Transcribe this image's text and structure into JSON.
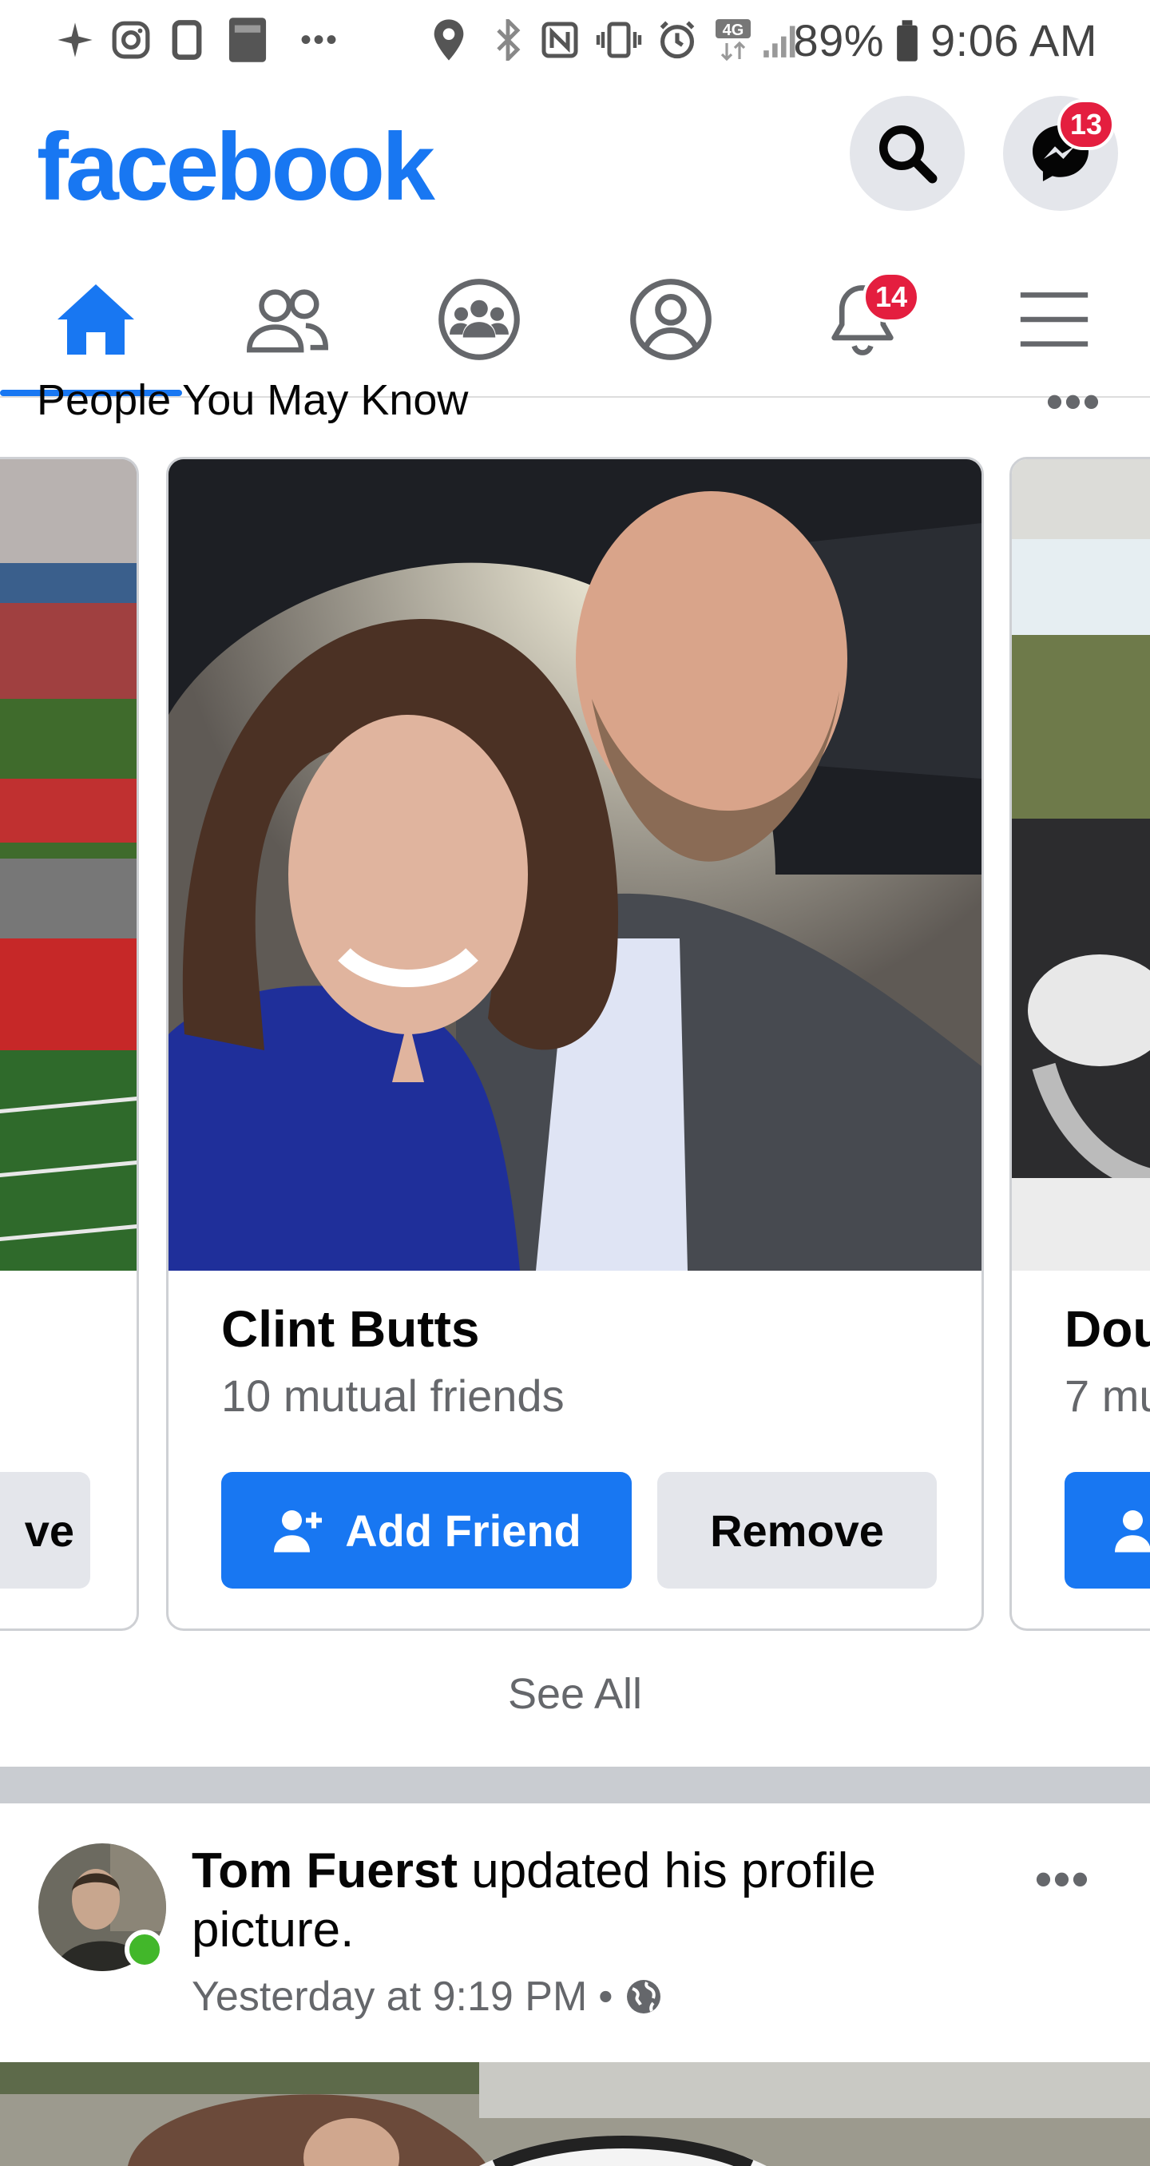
{
  "status_bar": {
    "battery": "89%",
    "time": "9:06 AM",
    "network": "4G"
  },
  "header": {
    "logo": "facebook",
    "messenger_badge": "13"
  },
  "nav": {
    "notifications_badge": "14"
  },
  "pymk": {
    "title": "People You May Know",
    "cards": [
      {
        "name": "Clint Butts",
        "mutual": "10 mutual friends",
        "add_label": "Add Friend",
        "remove_label": "Remove"
      },
      {
        "name": "Dou",
        "mutual": "7 mu"
      }
    ],
    "left_card_remove_partial": "ve",
    "see_all": "See All"
  },
  "post": {
    "author": "Tom Fuerst",
    "action": " updated his profile picture.",
    "time": "Yesterday at 9:19 PM",
    "separator": "•"
  },
  "colors": {
    "brand": "#1877f2",
    "badge": "#e41e3f",
    "online": "#42b72a"
  }
}
